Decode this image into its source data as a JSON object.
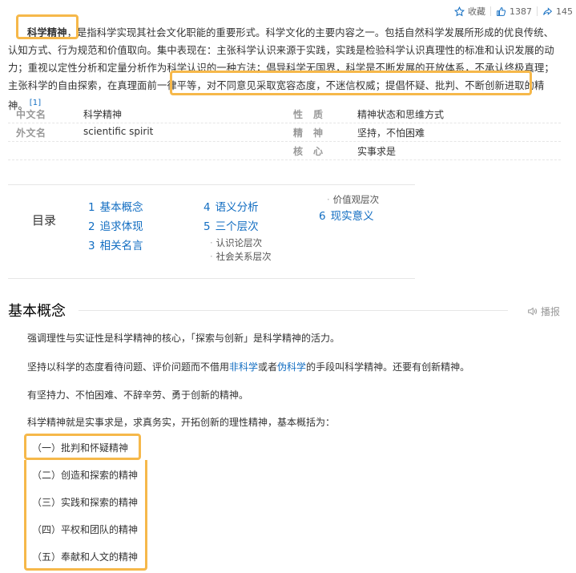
{
  "actions": {
    "collect_label": "收藏",
    "like_count": "1387",
    "share_count": "145"
  },
  "intro": {
    "term": "科学精神",
    "text1": "，是指科学实现其社会文化职能的重要形式。科学文化的主要内容之一。包括自然科学发展所形成的优良传统、认知方式、行为规范和价值取向。集中表现在：主张科学认识来源于实践，实践是检验科学认识真理性的标准和认识发展的动力；重视以定性分析和定量分析作为科学认识的一种方法；倡导科学无国界，科学是不断发展的开放体系，不承认终极真理；主张科学的自由探索，在真理面前一律平等，",
    "text2": "对不同意见采取宽容态度，不迷信权威；提倡怀疑、批判、不断创新进取的精神。",
    "ref": "[1]"
  },
  "infobox": {
    "rows": [
      {
        "k1": "中文名",
        "v1": "科学精神",
        "k2": "性　质",
        "v2": "精神状态和思维方式"
      },
      {
        "k1": "外文名",
        "v1": "scientific spirit",
        "k2": "精　神",
        "v2": "坚持，不怕困难"
      },
      {
        "k1": "",
        "v1": "",
        "k2": "核　心",
        "v2": "实事求是"
      }
    ]
  },
  "catalog": {
    "title": "目录",
    "col1": [
      {
        "num": "1",
        "label": "基本概念"
      },
      {
        "num": "2",
        "label": "追求体现"
      },
      {
        "num": "3",
        "label": "相关名言"
      }
    ],
    "col2": [
      {
        "num": "4",
        "label": "语义分析"
      },
      {
        "num": "5",
        "label": "三个层次"
      }
    ],
    "col2_subs": [
      "认识论层次",
      "社会关系层次"
    ],
    "col3_subs": [
      "价值观层次"
    ],
    "col3": [
      {
        "num": "6",
        "label": "现实意义"
      }
    ]
  },
  "section": {
    "title": "基本概念",
    "play_label": "播报",
    "p1": "强调理性与实证性是科学精神的核心，「探索与创新」是科学精神的活力。",
    "p2_a": "坚持以科学的态度看待问题、评价问题而不借用",
    "p2_link1": "非科学",
    "p2_b": "或者",
    "p2_link2": "伪科学",
    "p2_c": "的手段叫科学精神。还要有创新精神。",
    "p3": "有坚持力、不怕困难、不辞辛劳、勇于创新的精神。",
    "p4": "科学精神就是实事求是，求真务实，开拓创新的理性精神，基本概括为：",
    "list": [
      "（一）批判和怀疑精神",
      "（二）创造和探索的精神",
      "（三）实践和探索的精神",
      "（四）平权和团队的精神",
      "（五）奉献和人文的精神"
    ]
  },
  "colors": {
    "link": "#136ec2",
    "highlight_box": "#f6b84a"
  }
}
